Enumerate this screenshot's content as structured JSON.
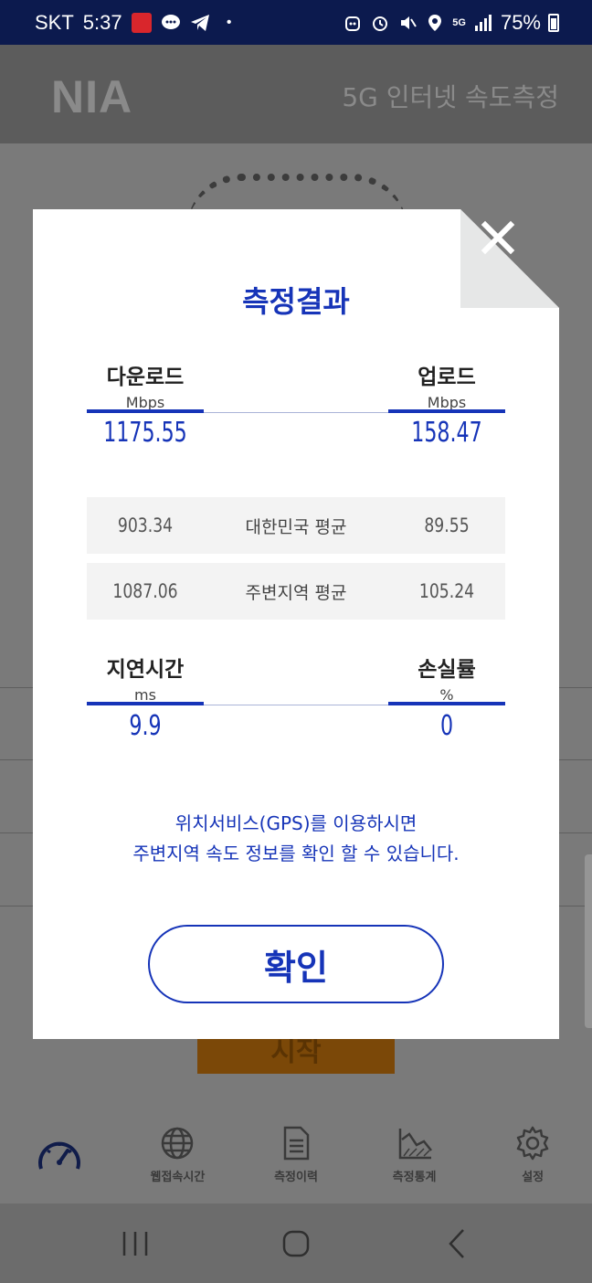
{
  "status_bar": {
    "carrier": "SKT",
    "time": "5:37",
    "network": "5G",
    "battery": "75%"
  },
  "app": {
    "logo": "NIA",
    "header_title": "5G 인터넷 속도측정",
    "start_label": "시작"
  },
  "modal": {
    "title": "측정결과",
    "download": {
      "label": "다운로드",
      "unit": "Mbps",
      "value": "1175.55"
    },
    "upload": {
      "label": "업로드",
      "unit": "Mbps",
      "value": "158.47"
    },
    "national_avg": {
      "label": "대한민국 평균",
      "download": "903.34",
      "upload": "89.55"
    },
    "local_avg": {
      "label": "주변지역 평균",
      "download": "1087.06",
      "upload": "105.24"
    },
    "latency": {
      "label": "지연시간",
      "unit": "ms",
      "value": "9.9"
    },
    "loss": {
      "label": "손실률",
      "unit": "%",
      "value": "0"
    },
    "gps_line1": "위치서비스(GPS)를 이용하시면",
    "gps_line2": "주변지역 속도 정보를 확인 할 수 있습니다.",
    "confirm_label": "확인"
  },
  "nav": [
    {
      "label": "",
      "icon": "speedometer-icon"
    },
    {
      "label": "웹접속시간",
      "icon": "globe-icon"
    },
    {
      "label": "측정이력",
      "icon": "document-icon"
    },
    {
      "label": "측정통계",
      "icon": "chart-icon"
    },
    {
      "label": "설정",
      "icon": "gear-icon"
    }
  ],
  "colors": {
    "accent": "#1634b8",
    "status_bar": "#0c1a4e",
    "overlay": "#7a7a7a"
  }
}
